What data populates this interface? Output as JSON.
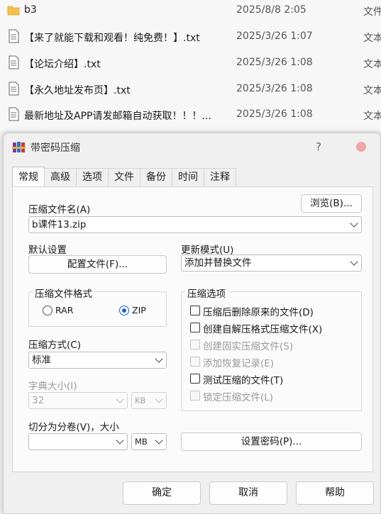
{
  "explorer": {
    "files": [
      {
        "name": "b3",
        "date": "2025/8/8 2:05",
        "type": "文件",
        "kind": "folder"
      },
      {
        "name": "【来了就能下载和观看！纯免费！】.txt",
        "date": "2025/3/26 1:07",
        "type": "文本",
        "kind": "text"
      },
      {
        "name": "【论坛介绍】.txt",
        "date": "2025/3/26 1:08",
        "type": "文本",
        "kind": "text"
      },
      {
        "name": "【永久地址发布页】.txt",
        "date": "2025/3/26 1:08",
        "type": "文本",
        "kind": "text"
      },
      {
        "name": "最新地址及APP请发邮箱自动获取！！！...",
        "date": "2025/3/26 1:08",
        "type": "文本",
        "kind": "text"
      }
    ]
  },
  "dialog": {
    "title": "带密码压缩",
    "help_glyph": "?",
    "tabs": [
      "常规",
      "高级",
      "选项",
      "文件",
      "备份",
      "时间",
      "注释"
    ],
    "archive_name_label": "压缩文件名(A)",
    "browse_label": "浏览(B)...",
    "archive_name_value": "b课件13.zip",
    "default_profile_label": "默认设置",
    "profiles_button": "配置文件(F)...",
    "update_mode_label": "更新模式(U)",
    "update_mode_value": "添加并替换文件",
    "format_group_title": "压缩文件格式",
    "format_rar": "RAR",
    "format_zip": "ZIP",
    "format_selected": "ZIP",
    "method_label": "压缩方式(C)",
    "method_value": "标准",
    "dict_label": "字典大小(I)",
    "dict_value": "32",
    "dict_unit": "KB",
    "split_label": "切分为分卷(V)，大小",
    "split_value": "",
    "split_unit": "MB",
    "options_group_title": "压缩选项",
    "options": [
      {
        "label": "压缩后删除原来的文件(D)",
        "checked": false,
        "enabled": true
      },
      {
        "label": "创建自解压格式压缩文件(X)",
        "checked": false,
        "enabled": true
      },
      {
        "label": "创建固实压缩文件(S)",
        "checked": false,
        "enabled": false
      },
      {
        "label": "添加恢复记录(E)",
        "checked": false,
        "enabled": false
      },
      {
        "label": "测试压缩的文件(T)",
        "checked": false,
        "enabled": true
      },
      {
        "label": "锁定压缩文件(L)",
        "checked": false,
        "enabled": false
      }
    ],
    "set_password_button": "设置密码(P)...",
    "ok_button": "确定",
    "cancel_button": "取消",
    "help_button": "帮助"
  },
  "colors": {
    "accent": "#1a62c7",
    "folder": "#f2c14e",
    "close_hint": "#f1a7a9"
  }
}
